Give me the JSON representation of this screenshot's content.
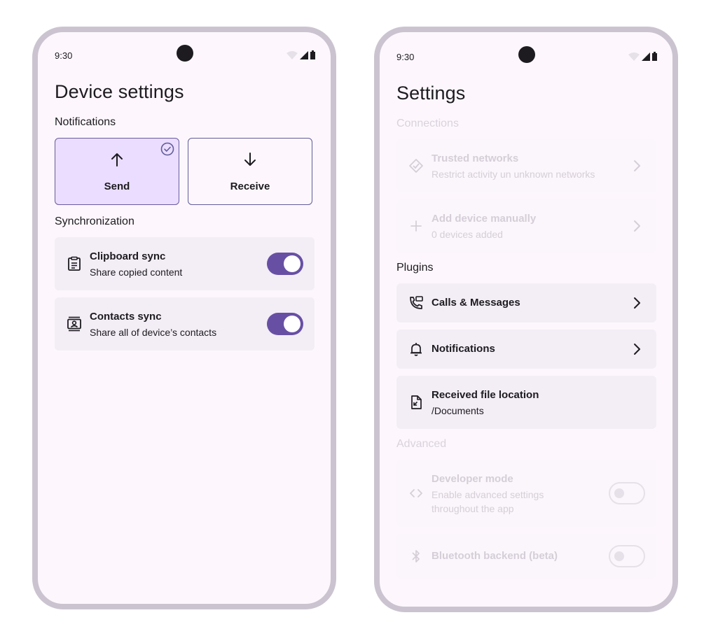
{
  "left_screen": {
    "status": {
      "time": "9:30"
    },
    "title": "Device settings",
    "notifications_section": "Notifications",
    "segments": [
      {
        "label": "Send",
        "icon": "arrow-up-icon",
        "selected": true
      },
      {
        "label": "Receive",
        "icon": "arrow-down-icon",
        "selected": false
      }
    ],
    "sync_section": "Synchronization",
    "sync_items": [
      {
        "title": "Clipboard sync",
        "subtitle": "Share copied content",
        "icon": "clipboard-icon",
        "enabled": true
      },
      {
        "title": "Contacts sync",
        "subtitle": "Share all of device’s contacts",
        "icon": "contacts-icon",
        "enabled": true
      }
    ]
  },
  "right_screen": {
    "status": {
      "time": "9:30"
    },
    "title": "Settings",
    "connections_section": "Connections",
    "connections": [
      {
        "title": "Trusted networks",
        "subtitle": "Restrict activity un unknown networks",
        "icon": "trusted-network-icon"
      },
      {
        "title": "Add device manually",
        "subtitle": "0 devices added",
        "icon": "plus-icon"
      }
    ],
    "plugins_section": "Plugins",
    "plugins": [
      {
        "title": "Calls & Messages",
        "icon": "phone-message-icon"
      },
      {
        "title": "Notifications",
        "icon": "bell-icon"
      },
      {
        "title": "Received file location",
        "subtitle": "/Documents",
        "icon": "file-location-icon"
      }
    ],
    "advanced_section": "Advanced",
    "advanced": [
      {
        "title": "Developer mode",
        "subtitle_line1": "Enable advanced settings",
        "subtitle_line2": "throughout the app",
        "icon": "code-icon",
        "enabled": false
      },
      {
        "title": "Bluetooth backend (beta)",
        "icon": "bluetooth-icon",
        "enabled": false
      }
    ]
  },
  "colors": {
    "accent": "#6750a4",
    "selected_segment": "#eaddff",
    "card_bg": "#f3edf6",
    "screen_bg": "#fdf7fd",
    "frame": "#cbc4d0"
  }
}
